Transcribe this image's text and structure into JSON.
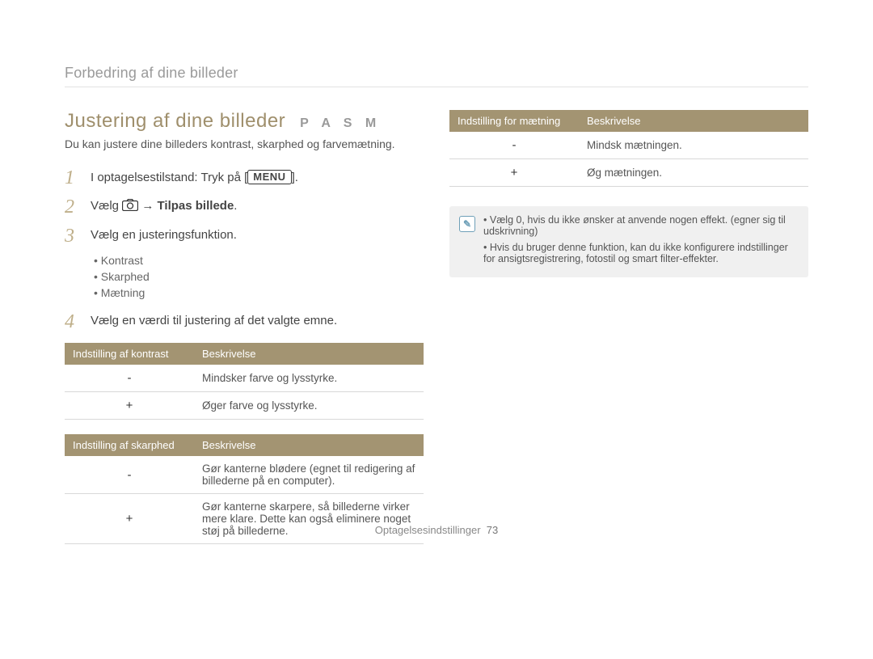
{
  "header": {
    "breadcrumb": "Forbedring af dine billeder"
  },
  "title": {
    "main": "Justering af dine billeder",
    "modes": "P A S M"
  },
  "intro": "Du kan justere dine billeders kontrast, skarphed og farvemætning.",
  "steps": {
    "s1": {
      "num": "1",
      "pre": "I optagelsestilstand: Tryk på [",
      "badge": "MENU",
      "post": "]."
    },
    "s2": {
      "num": "2",
      "pre": "Vælg ",
      "arrow": " → ",
      "strong": "Tilpas billede",
      "post": "."
    },
    "s3": {
      "num": "3",
      "text": "Vælg en justeringsfunktion.",
      "bullets": [
        "Kontrast",
        "Skarphed",
        "Mætning"
      ]
    },
    "s4": {
      "num": "4",
      "text": "Vælg en værdi til justering af det valgte emne."
    }
  },
  "tables": {
    "contrast": {
      "h1": "Indstilling af kontrast",
      "h2": "Beskrivelse",
      "rows": [
        {
          "sym": "-",
          "desc": "Mindsker farve og lysstyrke."
        },
        {
          "sym": "+",
          "desc": "Øger farve og lysstyrke."
        }
      ]
    },
    "sharpness": {
      "h1": "Indstilling af skarphed",
      "h2": "Beskrivelse",
      "rows": [
        {
          "sym": "-",
          "desc": "Gør kanterne blødere (egnet til redigering af billederne på en computer)."
        },
        {
          "sym": "+",
          "desc": "Gør kanterne skarpere, så billederne virker mere klare. Dette kan også eliminere noget støj på billederne."
        }
      ]
    },
    "saturation": {
      "h1": "Indstilling for mætning",
      "h2": "Beskrivelse",
      "rows": [
        {
          "sym": "-",
          "desc": "Mindsk mætningen."
        },
        {
          "sym": "+",
          "desc": "Øg mætningen."
        }
      ]
    }
  },
  "note": {
    "items": [
      "Vælg 0, hvis du ikke ønsker at anvende nogen effekt. (egner sig til udskrivning)",
      "Hvis du bruger denne funktion, kan du ikke konfigurere indstillinger for ansigtsregistrering, fotostil og smart filter-effekter."
    ]
  },
  "footer": {
    "section": "Optagelsesindstillinger",
    "page": "73"
  }
}
